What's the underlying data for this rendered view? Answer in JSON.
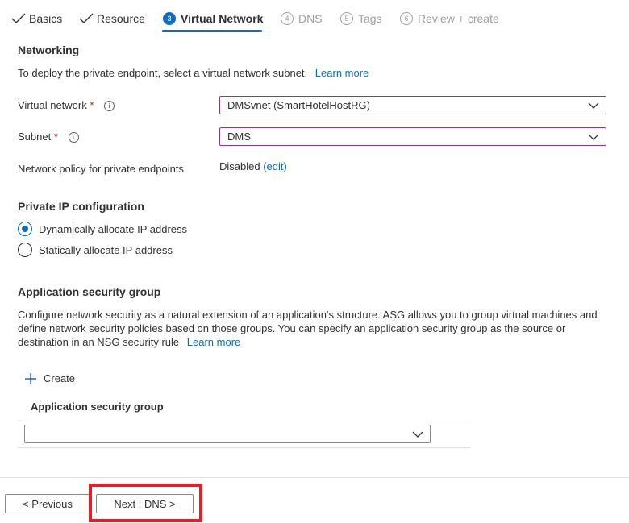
{
  "tabs": [
    {
      "label": "Basics",
      "state": "done"
    },
    {
      "label": "Resource",
      "state": "done"
    },
    {
      "number": "3",
      "label": "Virtual Network",
      "state": "active"
    },
    {
      "number": "4",
      "label": "DNS",
      "state": "disabled"
    },
    {
      "number": "5",
      "label": "Tags",
      "state": "disabled"
    },
    {
      "number": "6",
      "label": "Review + create",
      "state": "disabled"
    }
  ],
  "networking": {
    "title": "Networking",
    "description": "To deploy the private endpoint, select a virtual network subnet.",
    "learn_more": "Learn more",
    "virtual_network_label": "Virtual network",
    "virtual_network_value": "DMSvnet (SmartHotelHostRG)",
    "subnet_label": "Subnet",
    "subnet_value": "DMS",
    "required_marker": "*",
    "info_icon": "i",
    "policy_label": "Network policy for private endpoints",
    "policy_value": "Disabled",
    "policy_edit": "(edit)"
  },
  "private_ip": {
    "title": "Private IP configuration",
    "options": [
      {
        "label": "Dynamically allocate IP address",
        "checked": true
      },
      {
        "label": "Statically allocate IP address",
        "checked": false
      }
    ]
  },
  "asg": {
    "title": "Application security group",
    "description": "Configure network security as a natural extension of an application's structure. ASG allows you to group virtual machines and define network security policies based on those groups. You can specify an application security group as the source or destination in an NSG security rule",
    "learn_more": "Learn more",
    "create_label": "Create",
    "column_header": "Application security group",
    "selected_value": ""
  },
  "footer": {
    "previous_label": "< Previous",
    "next_label": "Next : DNS >"
  },
  "colors": {
    "accent": "#0f6cbd",
    "highlight": "#e0212b",
    "focus_border": "#8a3a8c"
  }
}
